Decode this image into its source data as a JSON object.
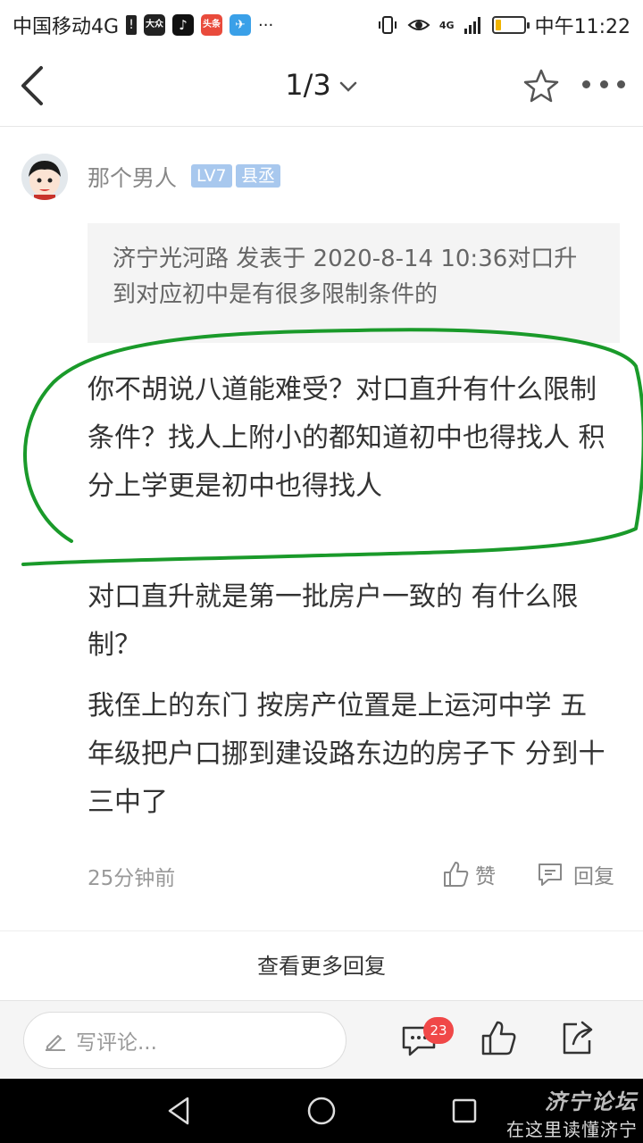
{
  "status_bar": {
    "carrier": "中国移动4G",
    "time": "中午11:22",
    "app_badges": [
      {
        "label": "大众",
        "color": "#222222"
      },
      {
        "label": "♪",
        "color": "#111111"
      },
      {
        "label": "头条",
        "color": "#e94b3c"
      },
      {
        "label": "✈",
        "color": "#3aa0e8"
      }
    ],
    "overflow": "···",
    "network_label": "4G",
    "battery_level": 0.2
  },
  "nav": {
    "page_indicator": "1/3"
  },
  "post": {
    "username": "那个男人",
    "level": "LV7",
    "rank": "县丞",
    "quote": "济宁光河路 发表于 2020-8-14 10:36对口升到对应初中是有很多限制条件的",
    "paragraphs": [
      "你不胡说八道能难受？对口直升有什么限制条件？找人上附小的都知道初中也得找人 积分上学更是初中也得找人",
      "对口直升就是第一批房户一致的 有什么限制？",
      "我侄上的东门 按房产位置是上运河中学 五年级把户口挪到建设路东边的房子下 分到十三中了"
    ],
    "time_ago": "25分钟前",
    "like_label": "赞",
    "reply_label": "回复"
  },
  "more_replies_label": "查看更多回复",
  "bottom_bar": {
    "comment_placeholder": "写评论...",
    "comment_count": "23"
  },
  "watermark": {
    "top": "济宁论坛",
    "bottom": "在这里读懂济宁"
  },
  "colors": {
    "accent_green": "#1a9a2a",
    "badge_blue": "#a8c8ee",
    "count_red": "#f04848"
  }
}
